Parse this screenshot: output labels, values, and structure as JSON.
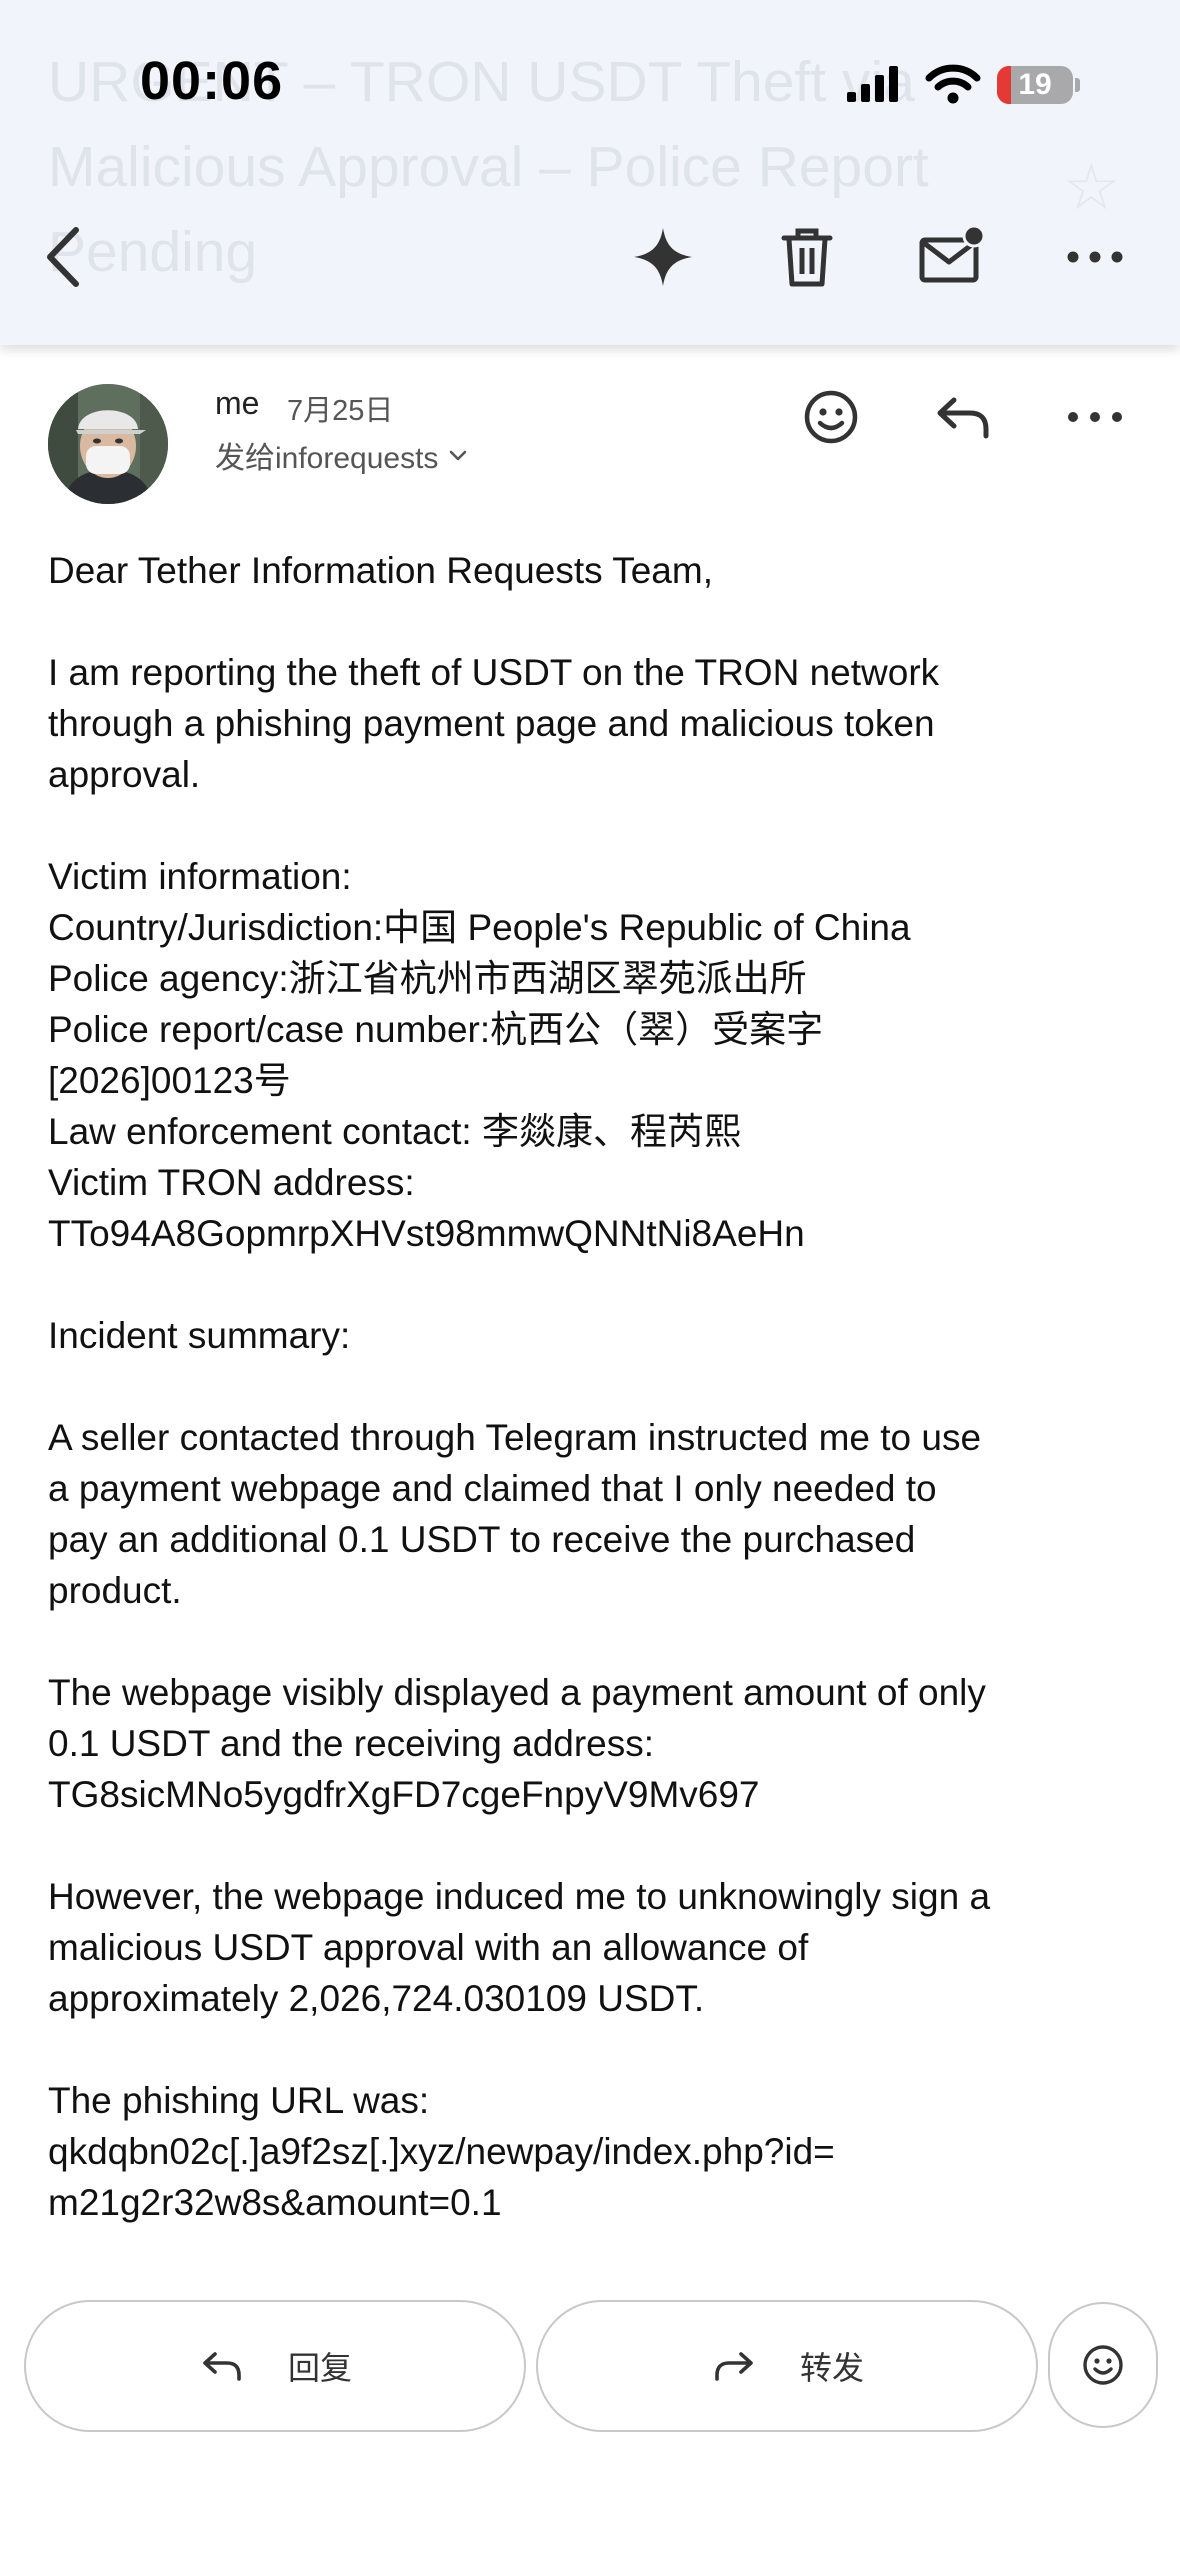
{
  "status_bar": {
    "time": "00:06",
    "battery": "19",
    "battery_level": 0.19
  },
  "header": {
    "subject": "URGENT – TRON USDT Theft via Malicious Approval – Police Report Pending",
    "icons": [
      "back-icon",
      "sparkle-icon",
      "trash-icon",
      "mark-unread-icon",
      "more-icon"
    ]
  },
  "sender": {
    "name": "me",
    "date": "7月25日",
    "recipient_line": "发给inforequests",
    "icons": [
      "smiley-icon",
      "reply-icon",
      "more-icon"
    ]
  },
  "body": {
    "lines": [
      "Dear Tether Information Requests Team,",
      "",
      "I am reporting the theft of USDT on the TRON network",
      "through a phishing payment page and malicious token",
      "approval.",
      "",
      "Victim information:",
      "Country/Jurisdiction:中国 People's Republic of China",
      "Police agency:浙江省杭州市西湖区翠苑派出所",
      "Police report/case number:杭西公（翠）受案字",
      "[2026]00123号",
      "Law enforcement contact: 李燚康、程芮熙",
      "Victim TRON address:",
      "TTo94A8GopmrpXHVst98mmwQNNtNi8AeHn",
      "",
      "Incident summary:",
      "",
      "A seller contacted through Telegram instructed me to use",
      "a payment webpage and claimed that I only needed to",
      "pay an additional 0.1 USDT to receive the purchased",
      "product.",
      "",
      "The webpage visibly displayed a payment amount of only",
      "0.1 USDT and the receiving address:",
      "TG8sicMNo5ygdfrXgFD7cgeFnpyV9Mv697",
      "",
      "However, the webpage induced me to unknowingly sign a",
      "malicious USDT approval with an allowance of",
      "approximately 2,026,724.030109 USDT.",
      "",
      "The phishing URL was:",
      "qkdqbn02c[.]a9f2sz[.]xyz/newpay/index.php?id=",
      "m21g2r32w8s&amount=0.1"
    ]
  },
  "bottom_bar": {
    "reply_label": "回复",
    "forward_label": "转发",
    "icons": [
      "reply-icon",
      "forward-icon",
      "smiley-icon"
    ]
  }
}
